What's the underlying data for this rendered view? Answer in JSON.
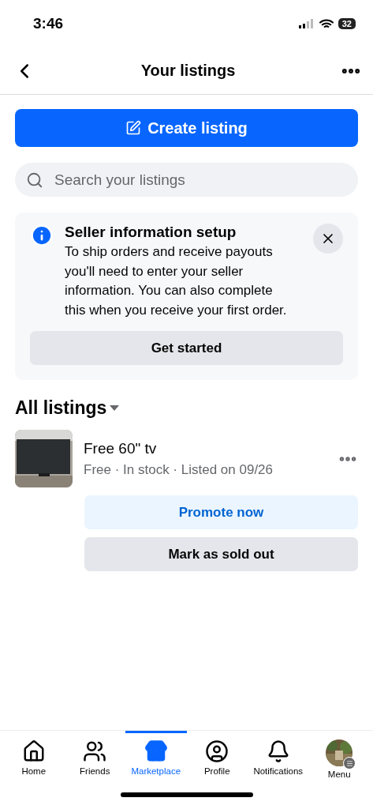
{
  "status_bar": {
    "time": "3:46",
    "battery": "32"
  },
  "header": {
    "title": "Your listings"
  },
  "create_button": {
    "label": "Create listing"
  },
  "search": {
    "placeholder": "Search your listings"
  },
  "notice": {
    "title": "Seller information setup",
    "body": "To ship orders and receive payouts you'll need to enter your seller information. You can also complete this when you receive your first order.",
    "button": "Get started"
  },
  "section": {
    "title": "All listings"
  },
  "listings": [
    {
      "title": "Free 60\" tv",
      "details": "Free · In stock · Listed on 09/26",
      "actions": [
        "Promote now",
        "Mark as sold out"
      ]
    }
  ],
  "tabs": [
    {
      "label": "Home",
      "kind": "home",
      "selected": false
    },
    {
      "label": "Friends",
      "kind": "friends",
      "selected": false
    },
    {
      "label": "Marketplace",
      "kind": "marketplace",
      "selected": true
    },
    {
      "label": "Profile",
      "kind": "profile",
      "selected": false
    },
    {
      "label": "Notifications",
      "kind": "notifications",
      "selected": false
    },
    {
      "label": "Menu",
      "kind": "menu",
      "selected": false
    }
  ]
}
